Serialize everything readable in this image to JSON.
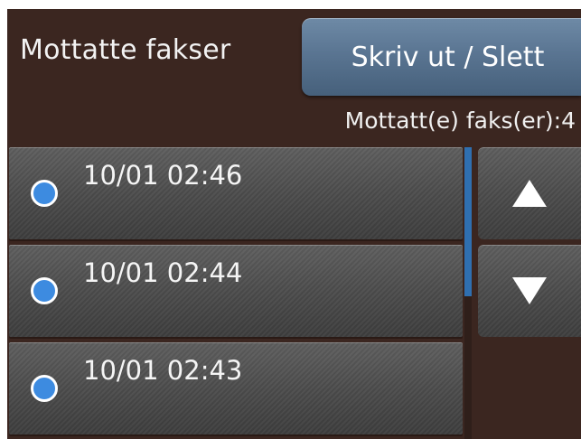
{
  "header": {
    "title": "Mottatte fakser",
    "print_delete_label": "Skriv ut / Slett"
  },
  "status": {
    "received_count": "Mottatt(e) faks(er):4"
  },
  "faxes": [
    {
      "timestamp": "10/01 02:46"
    },
    {
      "timestamp": "10/01 02:44"
    },
    {
      "timestamp": "10/01 02:43"
    }
  ],
  "icons": {
    "fax_dot": "blue-dot-icon",
    "scroll_up": "triangle-up-icon",
    "scroll_down": "triangle-down-icon"
  },
  "colors": {
    "background": "#3b2620",
    "accent_button": "#5a7592",
    "dot": "#3d8be0",
    "scroll_thumb": "#2f6fb0"
  }
}
